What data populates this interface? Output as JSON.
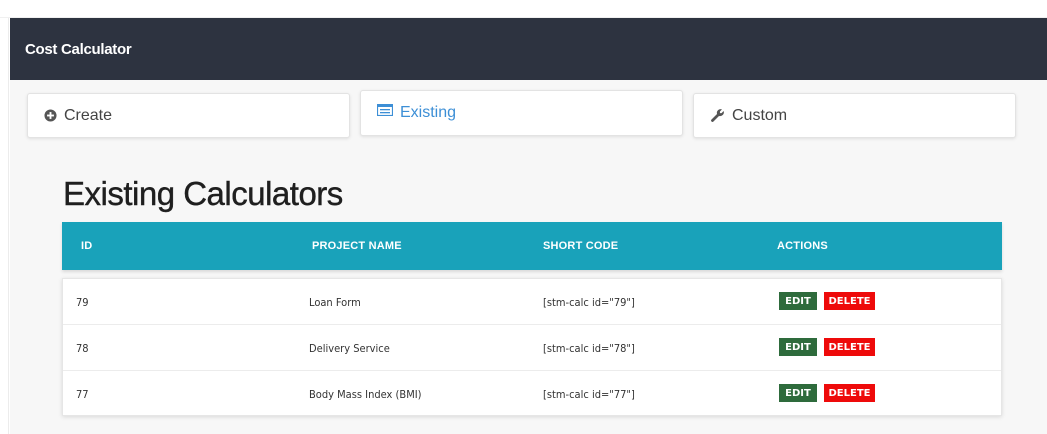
{
  "header": {
    "title": "Cost Calculator"
  },
  "tabs": [
    {
      "label": "Create",
      "icon": "plus-circle-icon"
    },
    {
      "label": "Existing",
      "icon": "list-icon",
      "active": true
    },
    {
      "label": "Custom",
      "icon": "wrench-icon"
    }
  ],
  "page_title": "Existing Calculators",
  "table": {
    "columns": [
      "ID",
      "PROJECT NAME",
      "SHORT CODE",
      "ACTIONS"
    ],
    "rows": [
      {
        "id": "79",
        "project_name": "Loan Form",
        "short_code": "[stm-calc id=\"79\"]"
      },
      {
        "id": "78",
        "project_name": "Delivery Service",
        "short_code": "[stm-calc id=\"78\"]"
      },
      {
        "id": "77",
        "project_name": "Body Mass Index (BMI)",
        "short_code": "[stm-calc id=\"77\"]"
      }
    ],
    "edit_label": "EDIT",
    "delete_label": "DELETE"
  },
  "colors": {
    "header_bg": "#2d3340",
    "table_head_bg": "#19a2ba",
    "active_tab": "#3d8fd6",
    "edit_button": "#2e6b3c",
    "delete_button": "#ee0a0a"
  }
}
